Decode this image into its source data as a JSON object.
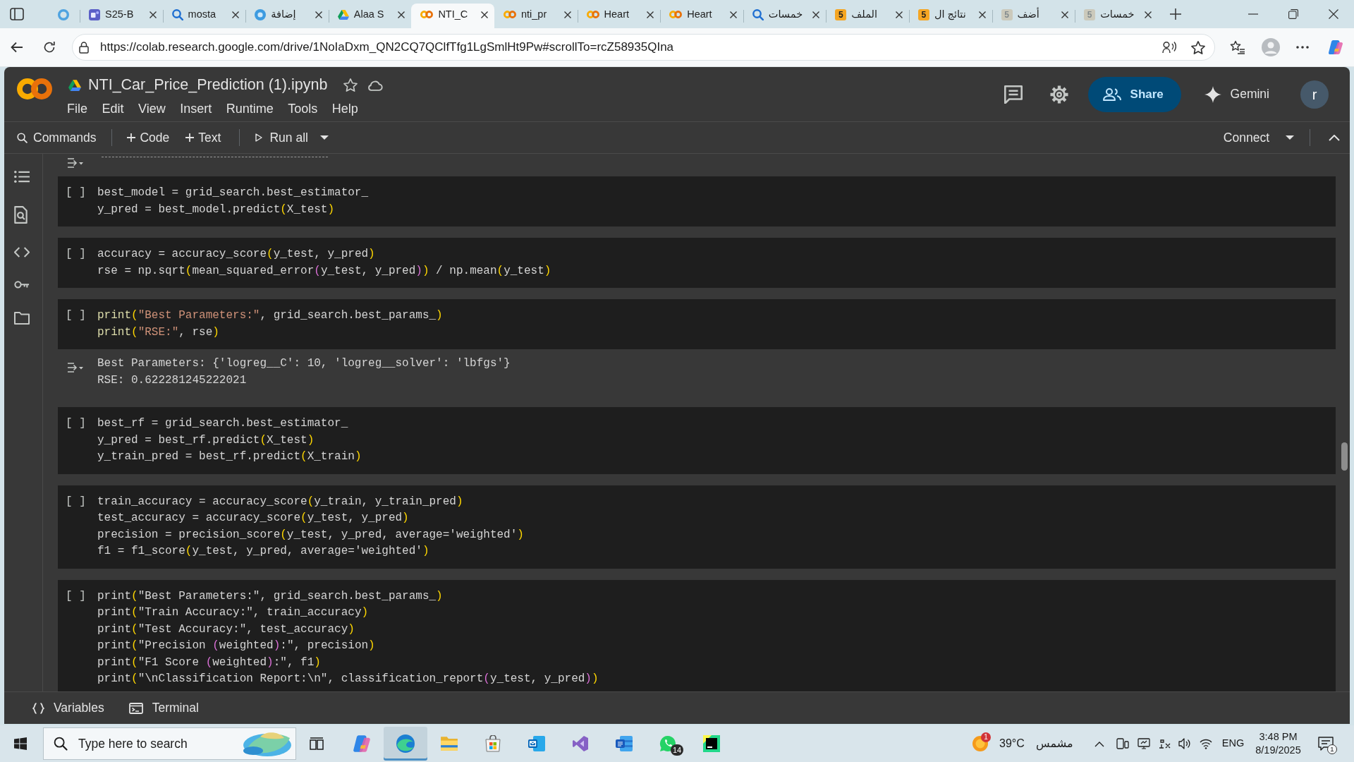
{
  "browser": {
    "tabs": [
      {
        "kind": "ring",
        "selected": false,
        "dimmed": false
      },
      {
        "kind": "tile",
        "title": "S25-B",
        "selected": false,
        "dimmed": false
      },
      {
        "kind": "search",
        "title": "mosta",
        "selected": false,
        "dimmed": false
      },
      {
        "kind": "disc",
        "title": "إضافة",
        "selected": false,
        "dimmed": false
      },
      {
        "kind": "triangle",
        "title": "Alaa S",
        "selected": false,
        "dimmed": false
      },
      {
        "kind": "rings",
        "title": "NTI_C",
        "selected": true,
        "dimmed": false
      },
      {
        "kind": "rings",
        "title": "nti_pr",
        "selected": false,
        "dimmed": false
      },
      {
        "kind": "rings",
        "title": "Heart",
        "selected": false,
        "dimmed": false
      },
      {
        "kind": "rings",
        "title": "Heart",
        "selected": false,
        "dimmed": false
      },
      {
        "kind": "search",
        "title": "خمسات",
        "selected": false,
        "dimmed": false
      },
      {
        "kind": "number",
        "icon_text": "5",
        "title": "الملف",
        "selected": false,
        "dimmed": false
      },
      {
        "kind": "number",
        "icon_text": "5",
        "title": "نتائج ال",
        "selected": false,
        "dimmed": false
      },
      {
        "kind": "number",
        "icon_text": "5",
        "title": "أضف",
        "selected": false,
        "dimmed": true
      },
      {
        "kind": "number",
        "icon_text": "5",
        "title": "خمسات",
        "selected": false,
        "dimmed": true
      }
    ],
    "url": "https://colab.research.google.com/drive/1NoIaDxm_QN2CQ7QClfTfg1LgSmlHt9Pw#scrollTo=rcZ58935QIna"
  },
  "notebook": {
    "title": "NTI_Car_Price_Prediction (1).ipynb",
    "menu": [
      "File",
      "Edit",
      "View",
      "Insert",
      "Runtime",
      "Tools",
      "Help"
    ],
    "share": "Share",
    "gemini": "Gemini",
    "avatar": "r",
    "toolbar": {
      "commands": "Commands",
      "add_code": "Code",
      "add_text": "Text",
      "run_all": "Run all",
      "connect": "Connect"
    },
    "cells": [
      {
        "prompt": "[ ]",
        "lines": [
          [
            {
              "text": "best_model = grid_search.best_estimator_",
              "kind": "plain"
            }
          ],
          [
            {
              "text": "y_pred = best_model.predict",
              "kind": "plain"
            },
            {
              "text": "(",
              "kind": "bracket"
            },
            {
              "text": "X_test",
              "kind": "plain"
            },
            {
              "text": ")",
              "kind": "bracket"
            }
          ]
        ]
      },
      {
        "prompt": "[ ]",
        "lines": [
          [
            {
              "text": "accuracy = accuracy_score",
              "kind": "plain"
            },
            {
              "text": "(",
              "kind": "bracket"
            },
            {
              "text": "y_test, y_pred",
              "kind": "plain"
            },
            {
              "text": ")",
              "kind": "bracket"
            }
          ],
          [
            {
              "text": "rse = np.sqrt",
              "kind": "plain"
            },
            {
              "text": "(",
              "kind": "bracket"
            },
            {
              "text": "mean_squared_error",
              "kind": "plain"
            },
            {
              "text": "(",
              "kind": "bracket2"
            },
            {
              "text": "y_test, y_pred",
              "kind": "plain"
            },
            {
              "text": ")",
              "kind": "bracket2"
            },
            {
              "text": ")",
              "kind": "bracket"
            },
            {
              "text": " / np.mean",
              "kind": "plain"
            },
            {
              "text": "(",
              "kind": "bracket"
            },
            {
              "text": "y_test",
              "kind": "plain"
            },
            {
              "text": ")",
              "kind": "bracket"
            }
          ]
        ]
      },
      {
        "prompt": "[ ]",
        "lines": [
          [
            {
              "text": "print",
              "kind": "builtin"
            },
            {
              "text": "(",
              "kind": "bracket"
            },
            {
              "text": "\"Best Parameters:\"",
              "kind": "string"
            },
            {
              "text": ", grid_search.best_params_",
              "kind": "plain"
            },
            {
              "text": ")",
              "kind": "bracket"
            }
          ],
          [
            {
              "text": "print",
              "kind": "builtin"
            },
            {
              "text": "(",
              "kind": "bracket"
            },
            {
              "text": "\"RSE:\"",
              "kind": "string"
            },
            {
              "text": ", rse",
              "kind": "plain"
            },
            {
              "text": ")",
              "kind": "bracket"
            }
          ]
        ],
        "output": [
          "Best Parameters: {'logreg__C': 10, 'logreg__solver': 'lbfgs'}",
          "RSE: 0.622281245222021"
        ]
      },
      {
        "prompt": "[ ]",
        "lines": [
          [
            {
              "text": "best_rf = grid_search.best_estimator_",
              "kind": "plain"
            }
          ],
          [
            {
              "text": "y_pred = best_rf.predict",
              "kind": "plain"
            },
            {
              "text": "(",
              "kind": "bracket"
            },
            {
              "text": "X_test",
              "kind": "plain"
            },
            {
              "text": ")",
              "kind": "bracket"
            }
          ],
          [
            {
              "text": "y_train_pred = best_rf.predict",
              "kind": "plain"
            },
            {
              "text": "(",
              "kind": "bracket"
            },
            {
              "text": "X_train",
              "kind": "plain"
            },
            {
              "text": ")",
              "kind": "bracket"
            }
          ]
        ]
      },
      {
        "prompt": "[ ]",
        "lines": [
          [
            {
              "text": "train_accuracy = accuracy_score",
              "kind": "plain"
            },
            {
              "text": "(",
              "kind": "bracket"
            },
            {
              "text": "y_train, y_train_pred",
              "kind": "plain"
            },
            {
              "text": ")",
              "kind": "bracket"
            }
          ],
          [
            {
              "text": "test_accuracy = accuracy_score",
              "kind": "plain"
            },
            {
              "text": "(",
              "kind": "bracket"
            },
            {
              "text": "y_test, y_pred",
              "kind": "plain"
            },
            {
              "text": ")",
              "kind": "bracket"
            }
          ],
          [
            {
              "text": "precision = precision_score",
              "kind": "plain"
            },
            {
              "text": "(",
              "kind": "bracket"
            },
            {
              "text": "y_test, y_pred, average='weighted'",
              "kind": "plain"
            },
            {
              "text": ")",
              "kind": "bracket"
            }
          ],
          [
            {
              "text": "f1 = f1_score",
              "kind": "plain"
            },
            {
              "text": "(",
              "kind": "bracket"
            },
            {
              "text": "y_test, y_pred, average='weighted'",
              "kind": "plain"
            },
            {
              "text": ")",
              "kind": "bracket"
            }
          ]
        ]
      },
      {
        "prompt": "[ ]",
        "lines": [
          [
            {
              "text": "print",
              "kind": "plain"
            },
            {
              "text": "(",
              "kind": "bracket"
            },
            {
              "text": "\"Best Parameters:\", grid_search.best_params_",
              "kind": "plain"
            },
            {
              "text": ")",
              "kind": "bracket"
            }
          ],
          [
            {
              "text": "print",
              "kind": "plain"
            },
            {
              "text": "(",
              "kind": "bracket"
            },
            {
              "text": "\"Train Accuracy:\", train_accuracy",
              "kind": "plain"
            },
            {
              "text": ")",
              "kind": "bracket"
            }
          ],
          [
            {
              "text": "print",
              "kind": "plain"
            },
            {
              "text": "(",
              "kind": "bracket"
            },
            {
              "text": "\"Test Accuracy:\", test_accuracy",
              "kind": "plain"
            },
            {
              "text": ")",
              "kind": "bracket"
            }
          ],
          [
            {
              "text": "print",
              "kind": "plain"
            },
            {
              "text": "(",
              "kind": "bracket"
            },
            {
              "text": "\"Precision ",
              "kind": "plain"
            },
            {
              "text": "(",
              "kind": "bracket2"
            },
            {
              "text": "weighted",
              "kind": "plain"
            },
            {
              "text": ")",
              "kind": "bracket2"
            },
            {
              "text": ":\", precision",
              "kind": "plain"
            },
            {
              "text": ")",
              "kind": "bracket"
            }
          ],
          [
            {
              "text": "print",
              "kind": "plain"
            },
            {
              "text": "(",
              "kind": "bracket"
            },
            {
              "text": "\"F1 Score ",
              "kind": "plain"
            },
            {
              "text": "(",
              "kind": "bracket2"
            },
            {
              "text": "weighted",
              "kind": "plain"
            },
            {
              "text": ")",
              "kind": "bracket2"
            },
            {
              "text": ":\", f1",
              "kind": "plain"
            },
            {
              "text": ")",
              "kind": "bracket"
            }
          ],
          [
            {
              "text": "print",
              "kind": "plain"
            },
            {
              "text": "(",
              "kind": "bracket"
            },
            {
              "text": "\"\\nClassification Report:\\n\", classification_report",
              "kind": "plain"
            },
            {
              "text": "(",
              "kind": "bracket2"
            },
            {
              "text": "y_test, y_pred",
              "kind": "plain"
            },
            {
              "text": ")",
              "kind": "bracket2"
            },
            {
              "text": ")",
              "kind": "bracket"
            }
          ]
        ]
      }
    ],
    "bottom_bar": {
      "variables": "Variables",
      "terminal": "Terminal"
    }
  },
  "taskbar": {
    "search": {
      "placeholder": "Type here to search"
    },
    "apps": [
      {
        "kind": "taskview",
        "selected": false
      },
      {
        "kind": "swirl",
        "selected": false
      },
      {
        "kind": "wave",
        "selected": true
      },
      {
        "kind": "folder",
        "selected": false
      },
      {
        "kind": "bag",
        "selected": false
      },
      {
        "kind": "mail",
        "selected": false
      },
      {
        "kind": "ribbon",
        "selected": false
      },
      {
        "kind": "doc",
        "selected": false
      },
      {
        "kind": "chat",
        "selected": false,
        "count": "14"
      },
      {
        "kind": "tile",
        "selected": false
      }
    ],
    "weather": {
      "alert_count": "1",
      "temperature": "39°C",
      "condition": "مشمس"
    },
    "language": "ENG",
    "time": "3:48 PM",
    "date": "8/19/2025",
    "notification_count": "1"
  }
}
